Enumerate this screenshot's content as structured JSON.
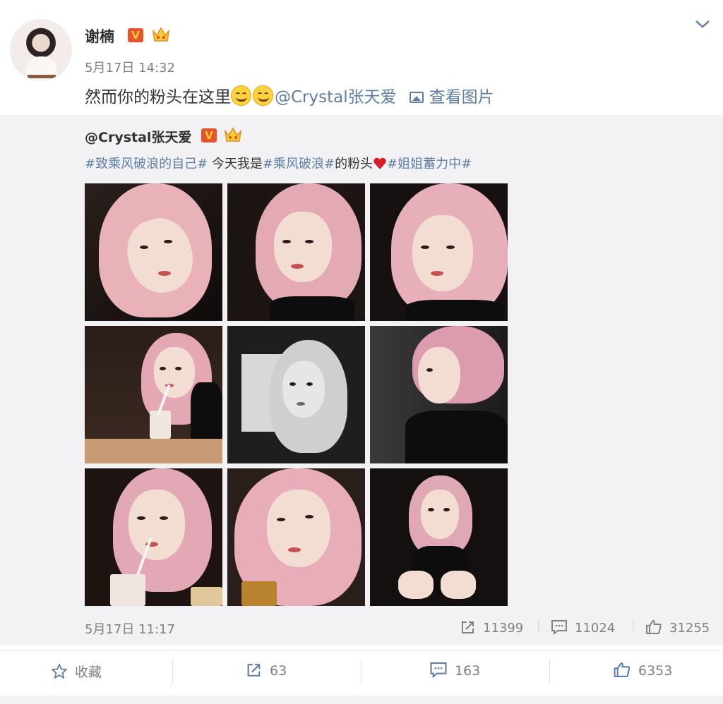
{
  "post": {
    "author": "谢楠",
    "verified_badge": "V",
    "time": "5月17日 14:32",
    "text_before": "然而你的粉头在这里",
    "emoji_names": [
      "grin-emoji",
      "grin-emoji"
    ],
    "mention": "@Crystal张天爱",
    "view_image_label": "查看图片"
  },
  "repost": {
    "author": "@Crystal张天爱",
    "verified_badge": "V",
    "tag1": "#致乘风破浪的自己#",
    "text1": " 今天我是",
    "tag2": "#乘风破浪#",
    "text2": "的粉头",
    "tag3": "#姐姐蓄力中#",
    "time": "5月17日 11:17",
    "reposts": "11399",
    "comments": "11024",
    "likes": "31255",
    "photo_count": 9
  },
  "actions": {
    "favorite_label": "收藏",
    "repost_count": "63",
    "comment_count": "163",
    "like_count": "6353"
  },
  "colors": {
    "link": "#5d7ea8",
    "muted": "#808080",
    "repost_bg": "#f2f2f5",
    "badge": "#e8532c"
  }
}
